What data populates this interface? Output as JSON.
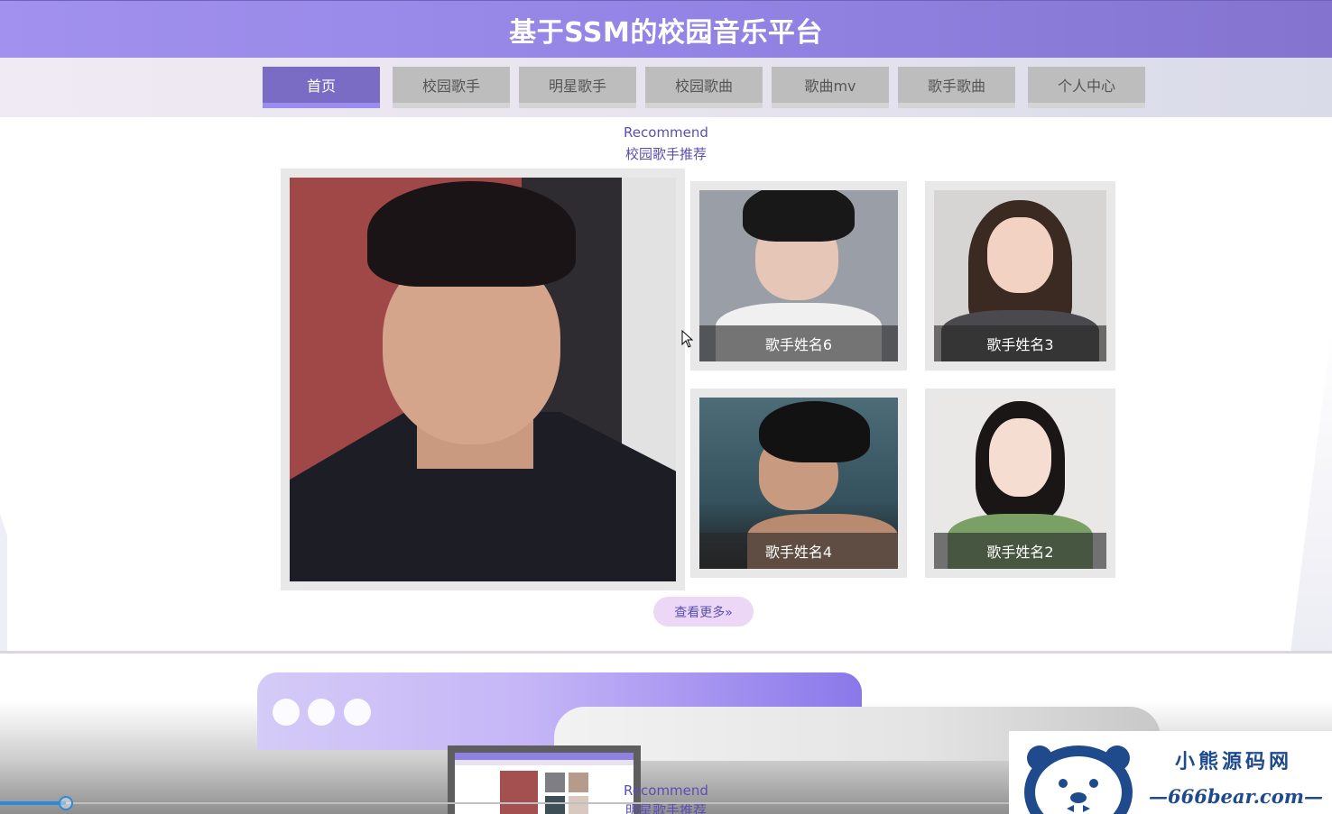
{
  "header": {
    "title": "基于SSM的校园音乐平台"
  },
  "nav": {
    "items": [
      {
        "label": "首页",
        "active": true
      },
      {
        "label": "校园歌手",
        "active": false
      },
      {
        "label": "明星歌手",
        "active": false
      },
      {
        "label": "校园歌曲",
        "active": false
      },
      {
        "label": "歌曲mv",
        "active": false
      },
      {
        "label": "歌手歌曲",
        "active": false
      },
      {
        "label": "个人中心",
        "active": false
      }
    ]
  },
  "recommend": {
    "subtitle_en": "Recommend",
    "subtitle_cn": "校园歌手推荐",
    "cards": [
      {
        "name": "歌手姓名6"
      },
      {
        "name": "歌手姓名3"
      },
      {
        "name": "歌手姓名4"
      },
      {
        "name": "歌手姓名2"
      }
    ],
    "more_label": "查看更多»"
  },
  "lower_section": {
    "subtitle_en": "Recommend",
    "subtitle_cn": "明星歌手推荐"
  },
  "video_progress": {
    "fraction": 0.065
  },
  "watermark": {
    "name": "小熊源码网",
    "url": "—666bear.com—"
  },
  "colors": {
    "accent": "#7a6cc5",
    "header_gradient_start": "#a291ee",
    "header_gradient_end": "#8474cf",
    "text_purple": "#5a4fb0",
    "nav_inactive": "#bdbdbd",
    "more_button_bg": "#ecd8f6",
    "progress": "#2d8ad8"
  }
}
